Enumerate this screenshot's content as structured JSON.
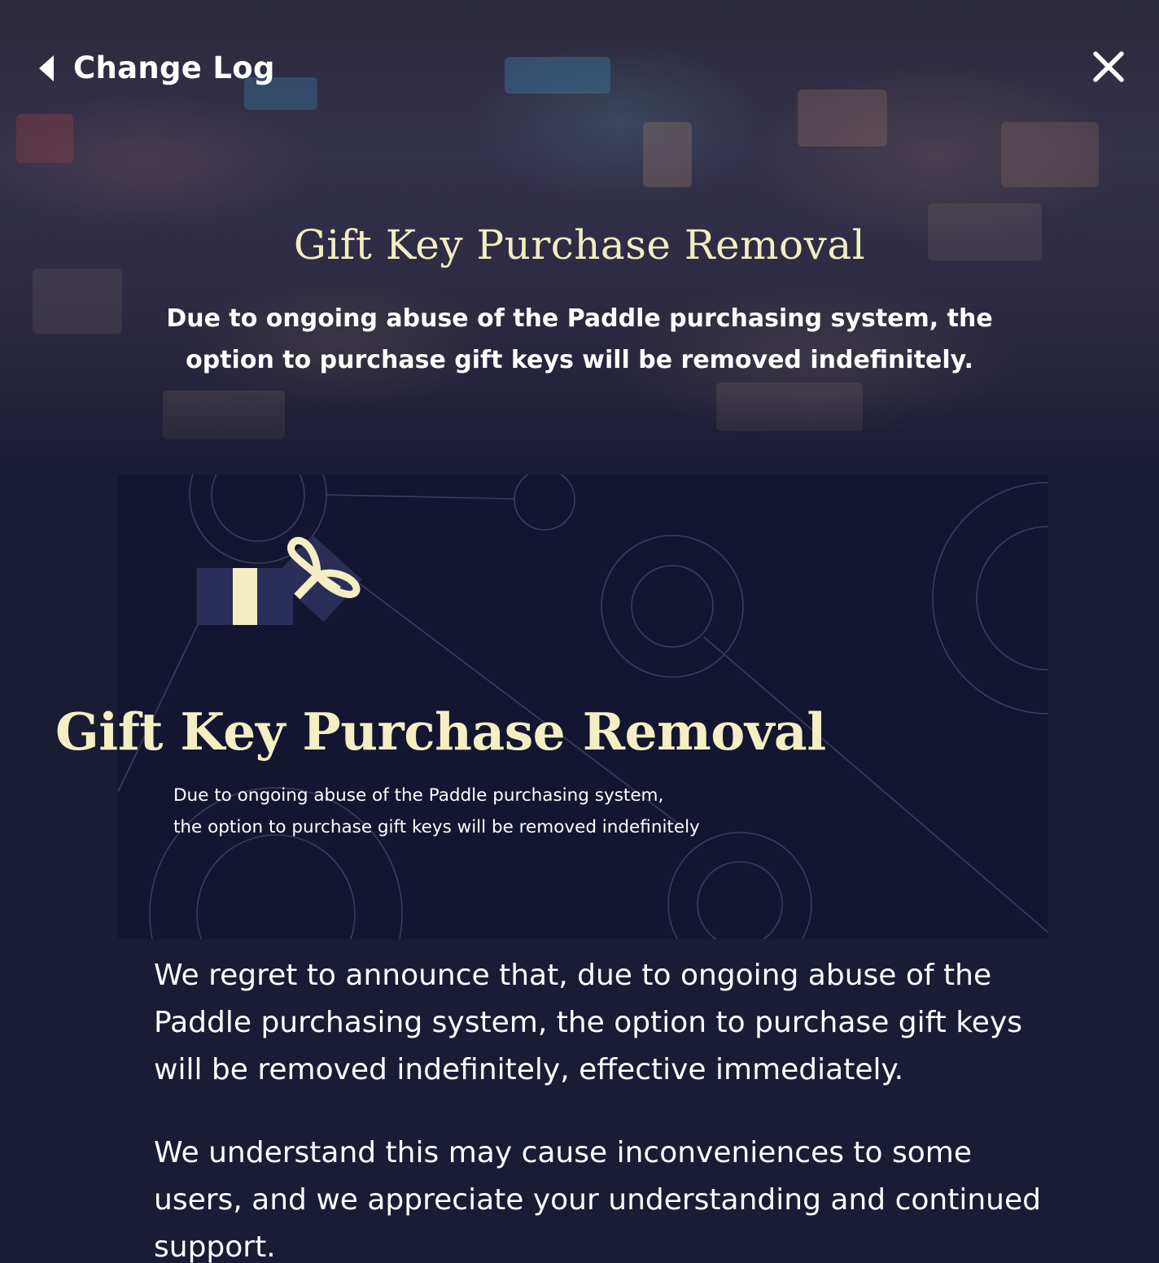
{
  "header": {
    "back_label": "Change Log",
    "back_icon": "chevron-left-icon",
    "close_icon": "close-icon"
  },
  "hero": {
    "title": "Gift Key Purchase Removal",
    "subtitle": "Due to ongoing abuse of the Paddle purchasing system, the option to purchase gift keys will be removed indefinitely."
  },
  "banner": {
    "icon": "gift-icon",
    "title": "Gift Key Purchase Removal",
    "line1": "Due to ongoing abuse of the Paddle purchasing system,",
    "line2": "the option to purchase gift keys will be removed indefinitely"
  },
  "body": {
    "paragraph1": "We regret to announce that, due to ongoing abuse of the Paddle purchasing system, the option to purchase gift keys will be removed indefinitely, effective immediately.",
    "paragraph2": "We understand this may cause inconveniences to some users, and we appreciate your understanding and continued support."
  },
  "colors": {
    "background": "#1a1b35",
    "title_accent": "#f3eec0",
    "banner_background": "#141631",
    "text": "#ffffff"
  }
}
